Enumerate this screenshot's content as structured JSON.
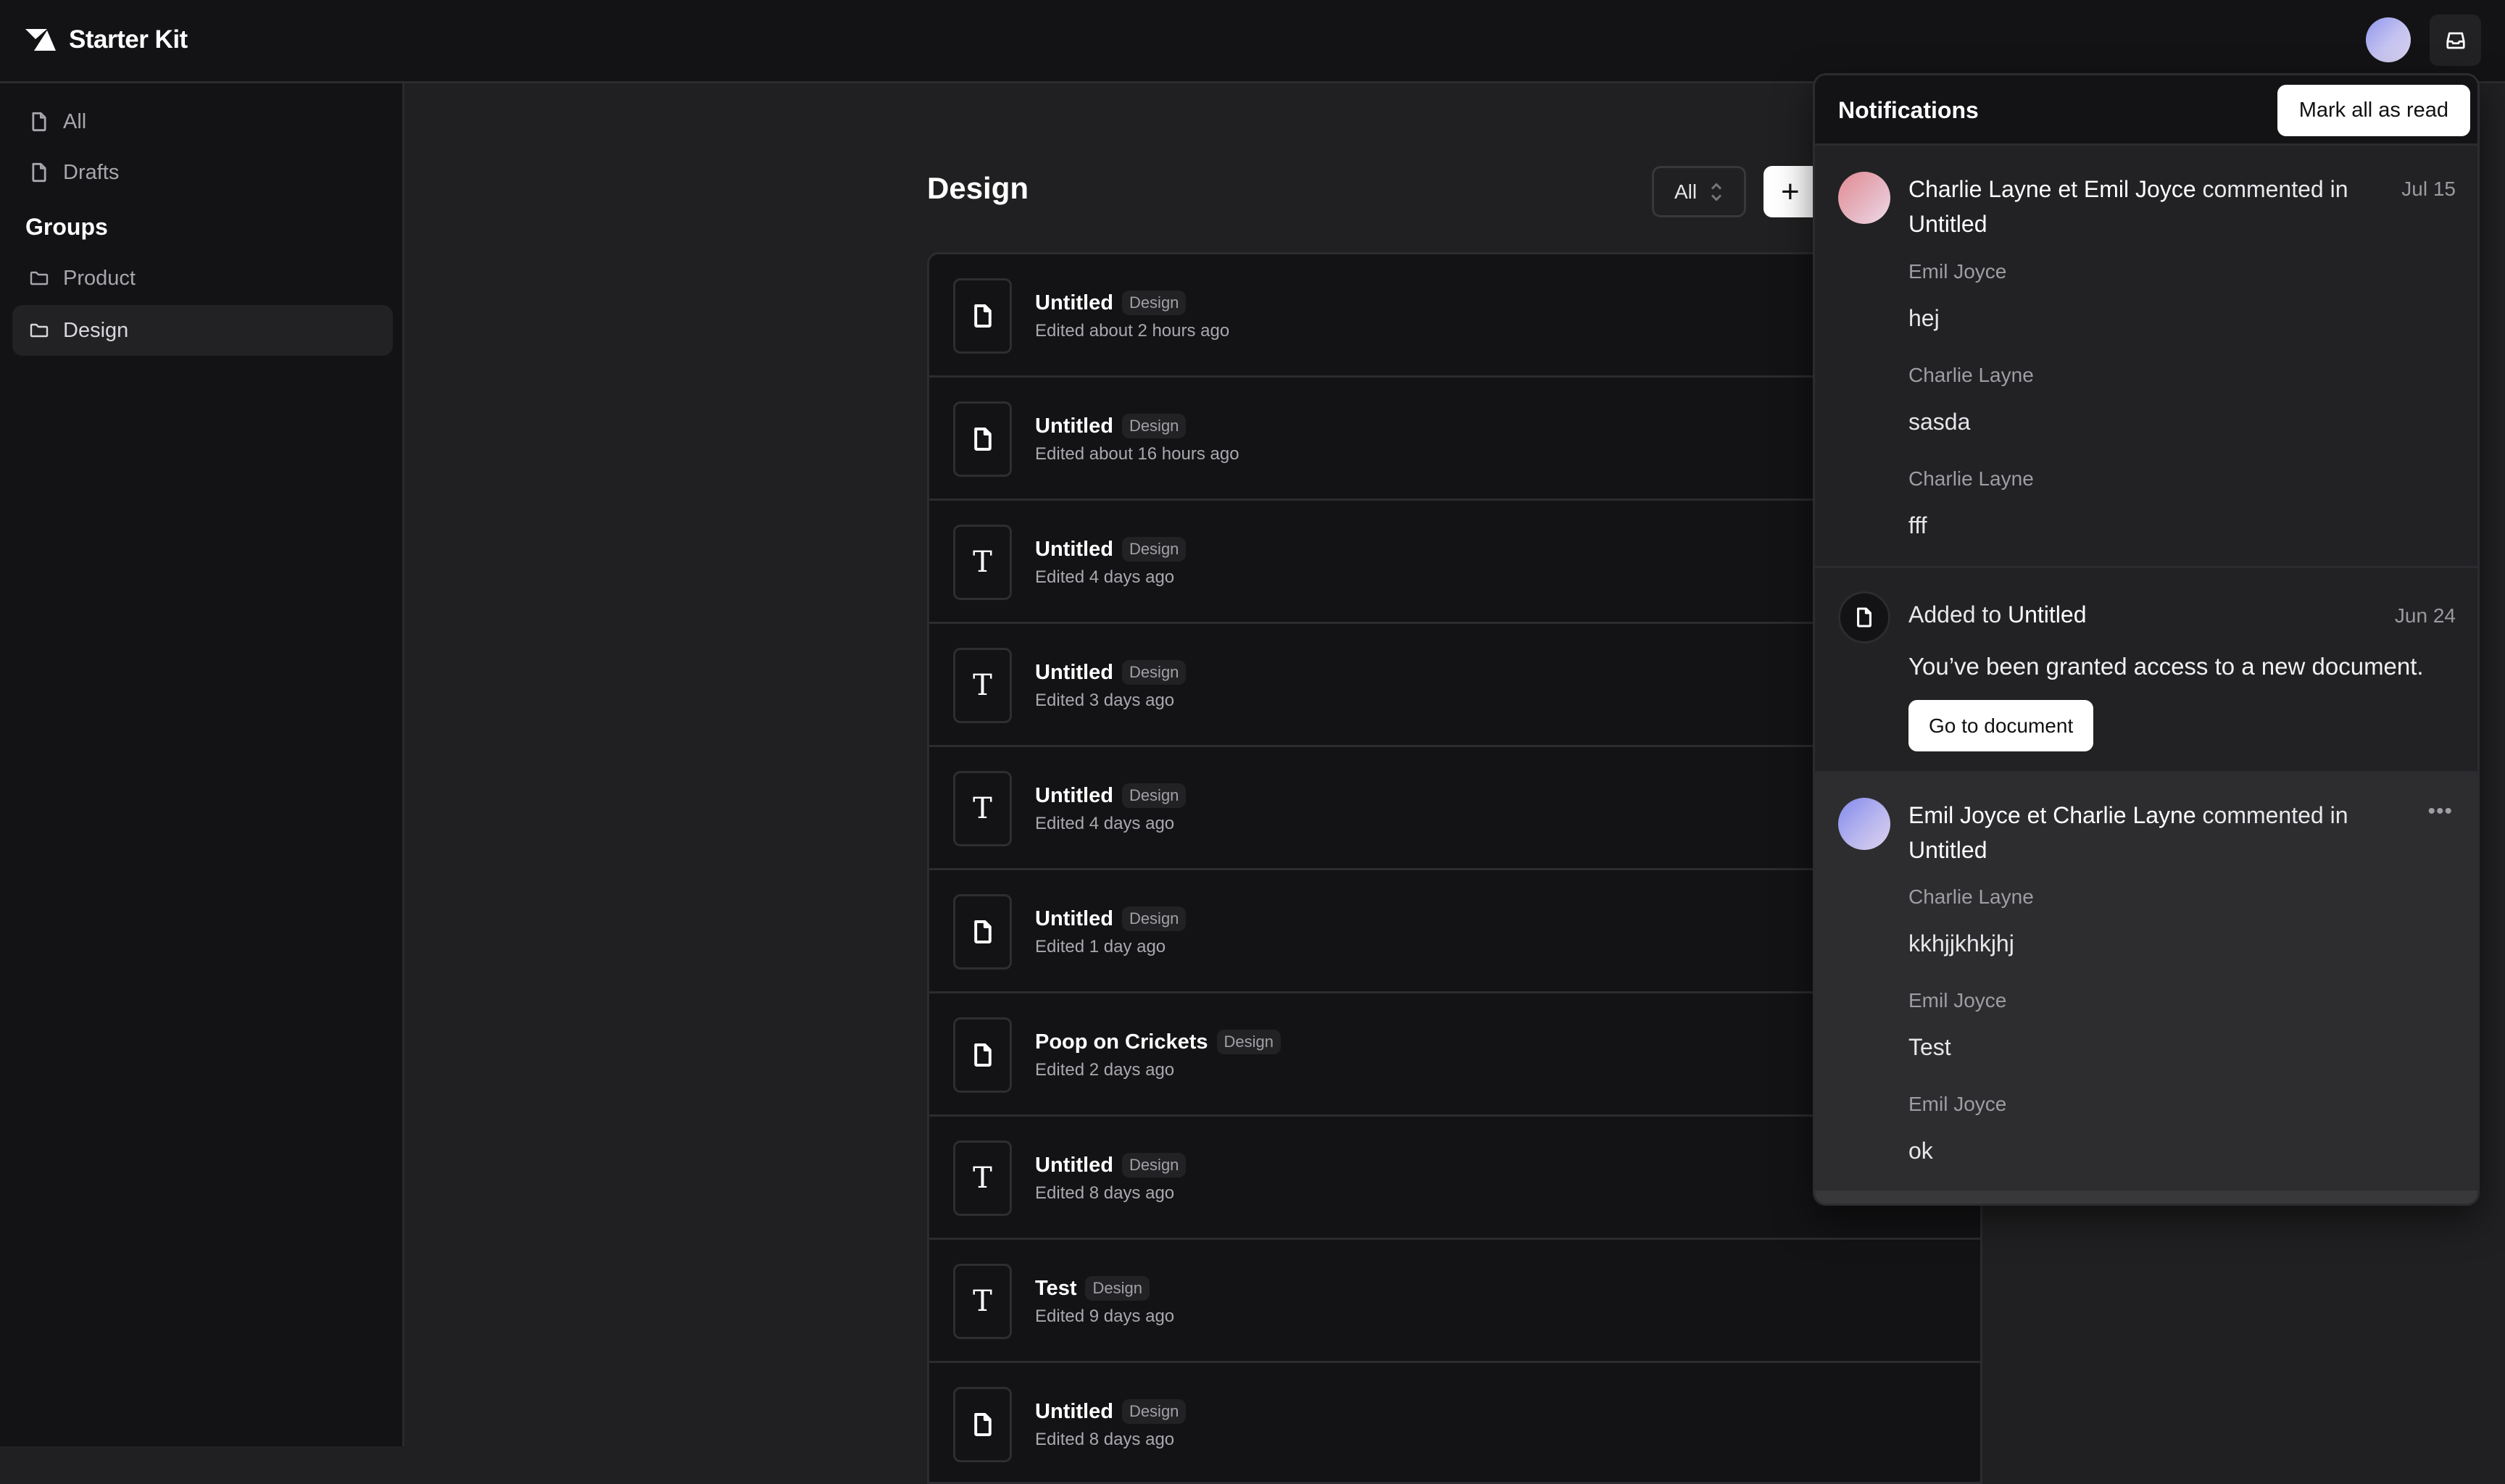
{
  "app": {
    "title": "Starter Kit"
  },
  "sidebar": {
    "items": [
      {
        "label": "All",
        "icon": "file-icon"
      },
      {
        "label": "Drafts",
        "icon": "file-icon"
      }
    ],
    "groups_label": "Groups",
    "groups": [
      {
        "label": "Product",
        "icon": "folder-icon",
        "selected": false
      },
      {
        "label": "Design",
        "icon": "folder-icon",
        "selected": true
      }
    ]
  },
  "main": {
    "title": "Design",
    "filter": {
      "value": "All"
    },
    "new_button_label": "+",
    "documents": [
      {
        "title": "Untitled",
        "tag": "Design",
        "meta": "Edited about 2 hours ago",
        "type": "document"
      },
      {
        "title": "Untitled",
        "tag": "Design",
        "meta": "Edited about 16 hours ago",
        "type": "document"
      },
      {
        "title": "Untitled",
        "tag": "Design",
        "meta": "Edited 4 days ago",
        "type": "text"
      },
      {
        "title": "Untitled",
        "tag": "Design",
        "meta": "Edited 3 days ago",
        "type": "text"
      },
      {
        "title": "Untitled",
        "tag": "Design",
        "meta": "Edited 4 days ago",
        "type": "text"
      },
      {
        "title": "Untitled",
        "tag": "Design",
        "meta": "Edited 1 day ago",
        "type": "document"
      },
      {
        "title": "Poop on Crickets",
        "tag": "Design",
        "meta": "Edited 2 days ago",
        "type": "document"
      },
      {
        "title": "Untitled",
        "tag": "Design",
        "meta": "Edited 8 days ago",
        "type": "text"
      },
      {
        "title": "Test",
        "tag": "Design",
        "meta": "Edited 9 days ago",
        "type": "text"
      },
      {
        "title": "Untitled",
        "tag": "Design",
        "meta": "Edited 8 days ago",
        "type": "document"
      }
    ],
    "text_glyph": "T"
  },
  "notifications": {
    "title": "Notifications",
    "mark_all_label": "Mark all as read",
    "items": [
      {
        "kind": "comment",
        "actors": "Charlie Layne et Emil Joyce",
        "verb": "commented in",
        "target": "Untitled",
        "date": "Jul 15",
        "comments": [
          {
            "author": "Emil Joyce",
            "body": "hej"
          },
          {
            "author": "Charlie Layne",
            "body": "sasda"
          },
          {
            "author": "Charlie Layne",
            "body": "fff"
          }
        ]
      },
      {
        "kind": "access",
        "prefix": "Added to",
        "target": "Untitled",
        "date": "Jun 24",
        "message": "You’ve been granted access to a new document.",
        "button_label": "Go to document"
      },
      {
        "kind": "comment",
        "actors": "Emil Joyce et Charlie Layne",
        "verb": "commented in",
        "target": "Untitled",
        "more_label": "•••",
        "comments": [
          {
            "author": "Charlie Layne",
            "body": "kkhjjkhkjhj"
          },
          {
            "author": "Emil Joyce",
            "body": "Test"
          },
          {
            "author": "Emil Joyce",
            "body": "ok"
          }
        ]
      }
    ]
  },
  "colors": {
    "background": "#202022",
    "surface": "#131315",
    "border": "#2c2c30",
    "hover": "#2c2c2e",
    "avatar_pink": "#e8a0a8",
    "avatar_purple": "#a3a6ee"
  }
}
